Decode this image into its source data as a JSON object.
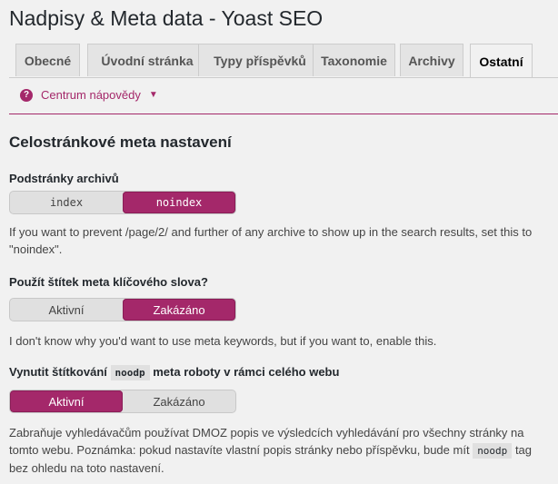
{
  "page": {
    "title": "Nadpisy & Meta data - Yoast SEO"
  },
  "tabs": [
    {
      "label": "Obecné"
    },
    {
      "label": "Úvodní stránka"
    },
    {
      "label": "Typy příspěvků"
    },
    {
      "label": "Taxonomie"
    },
    {
      "label": "Archivy"
    },
    {
      "label": "Ostatní",
      "active": true
    }
  ],
  "help": {
    "label": "Centrum nápovědy",
    "icon": "question-icon"
  },
  "section": {
    "title": "Celostránkové meta nastavení"
  },
  "fields": {
    "archive_subpages": {
      "label": "Podstránky archivů",
      "options": [
        "index",
        "noindex"
      ],
      "selected": "noindex",
      "description": "If you want to prevent /page/2/ and further of any archive to show up in the search results, set this to \"noindex\"."
    },
    "meta_keywords": {
      "label": "Použít štítek meta klíčového slova?",
      "options": [
        "Aktivní",
        "Zakázáno"
      ],
      "selected": "Zakázáno",
      "description": "I don't know why you'd want to use meta keywords, but if you want to, enable this."
    },
    "noodp": {
      "label_before": "Vynutit štítkování",
      "label_code": "noodp",
      "label_after": "meta roboty v rámci celého webu",
      "options": [
        "Aktivní",
        "Zakázáno"
      ],
      "selected": "Aktivní",
      "description_before": "Zabraňuje vyhledávačům používat DMOZ popis ve výsledcích vyhledávání pro všechny stránky na tomto webu. Poznámka: pokud nastavíte vlastní popis stránky nebo příspěvku, bude mít",
      "description_code": "noodp",
      "description_after": "tag bez ohledu na toto nastavení."
    }
  },
  "colors": {
    "accent": "#a4286a",
    "background": "#f1f1f1"
  }
}
